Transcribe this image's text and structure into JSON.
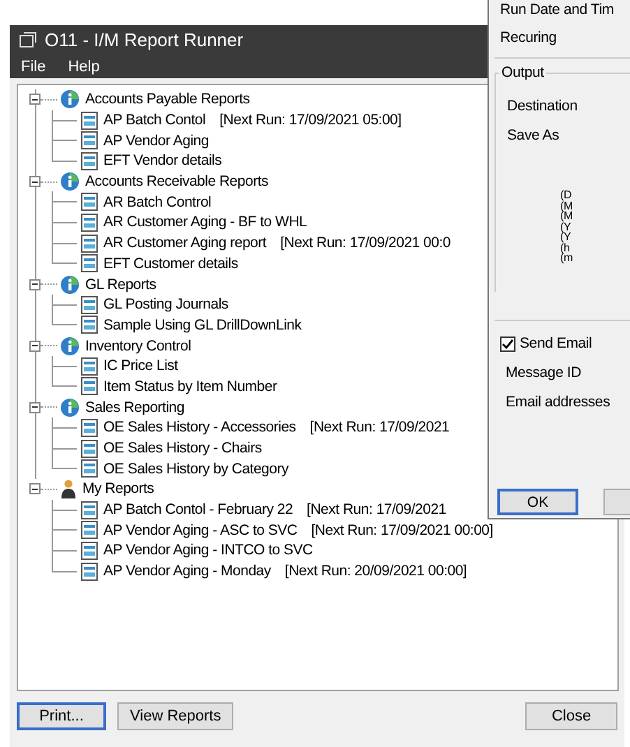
{
  "window": {
    "title": "O11 - I/M Report Runner"
  },
  "menu": [
    "File",
    "Help"
  ],
  "tree": [
    {
      "label": "Accounts Payable Reports",
      "kind": "info",
      "expanded": true,
      "children": [
        {
          "label": "AP Batch Contol",
          "schedule": "[Next Run: 17/09/2021 05:00]"
        },
        {
          "label": "AP Vendor Aging"
        },
        {
          "label": "EFT Vendor details"
        }
      ]
    },
    {
      "label": "Accounts Receivable Reports",
      "kind": "info",
      "expanded": true,
      "children": [
        {
          "label": "AR Batch Control"
        },
        {
          "label": "AR Customer Aging - BF to WHL"
        },
        {
          "label": "AR Customer Aging report",
          "schedule": "[Next Run: 17/09/2021 00:0"
        },
        {
          "label": "EFT Customer details"
        }
      ]
    },
    {
      "label": "GL Reports",
      "kind": "info",
      "expanded": true,
      "children": [
        {
          "label": "GL Posting Journals"
        },
        {
          "label": "Sample Using GL DrillDownLink"
        }
      ]
    },
    {
      "label": "Inventory Control",
      "kind": "info",
      "expanded": true,
      "children": [
        {
          "label": "IC Price List"
        },
        {
          "label": "Item Status by Item Number"
        }
      ]
    },
    {
      "label": "Sales Reporting",
      "kind": "info",
      "expanded": true,
      "children": [
        {
          "label": "OE Sales History - Accessories",
          "schedule": "[Next Run: 17/09/2021"
        },
        {
          "label": "OE Sales History - Chairs"
        },
        {
          "label": "OE Sales History by Category"
        }
      ]
    },
    {
      "label": "My Reports",
      "kind": "person",
      "expanded": true,
      "children": [
        {
          "label": "AP Batch Contol - February 22",
          "schedule": "[Next Run: 17/09/2021"
        },
        {
          "label": "AP Vendor Aging - ASC to SVC",
          "schedule": "[Next Run: 17/09/2021 00:00]"
        },
        {
          "label": "AP Vendor Aging - INTCO to SVC"
        },
        {
          "label": "AP Vendor Aging - Monday",
          "schedule": "[Next Run: 20/09/2021 00:00]"
        }
      ]
    }
  ],
  "buttons": [
    {
      "label": "Print...",
      "default": true
    },
    {
      "label": "View Reports",
      "default": false
    },
    {
      "label": "Close",
      "default": false
    }
  ],
  "dialog": {
    "fields": [
      "Run Date and Tim",
      "Recuring"
    ],
    "output_group": "Output",
    "output_fields": [
      "Destination",
      "Save As"
    ],
    "codes": [
      "(D",
      "(M",
      "(M",
      "(Y",
      "(Y",
      "(h",
      "(m"
    ],
    "send_email": {
      "label": "Send Email",
      "checked": true
    },
    "email_fields": [
      "Message ID",
      "Email addresses"
    ],
    "buttons": [
      {
        "label": "OK",
        "default": true
      },
      {
        "default": false
      }
    ]
  }
}
